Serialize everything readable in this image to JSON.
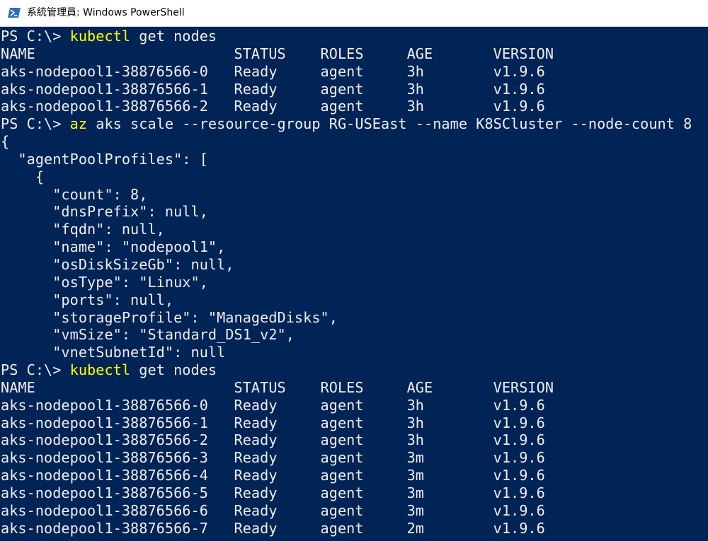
{
  "window": {
    "title": "系統管理員: Windows PowerShell",
    "icon": "powershell-icon"
  },
  "colors": {
    "console_background": "#012456",
    "console_text": "#eeedf0",
    "command_highlight": "#ffff00",
    "titlebar_background": "#ffffff"
  },
  "console": {
    "lines": [
      {
        "prompt": "PS C:\\> ",
        "cmd": "kubectl",
        "args": " get nodes"
      },
      {
        "text": "NAME                       STATUS    ROLES     AGE       VERSION"
      },
      {
        "text": "aks-nodepool1-38876566-0   Ready     agent     3h        v1.9.6"
      },
      {
        "text": "aks-nodepool1-38876566-1   Ready     agent     3h        v1.9.6"
      },
      {
        "text": "aks-nodepool1-38876566-2   Ready     agent     3h        v1.9.6"
      },
      {
        "prompt": "PS C:\\> ",
        "cmd": "az",
        "args": " aks scale --resource-group RG-USEast --name K8SCluster --node-count 8"
      },
      {
        "text": "{"
      },
      {
        "text": "  \"agentPoolProfiles\": ["
      },
      {
        "text": "    {"
      },
      {
        "text": "      \"count\": 8,"
      },
      {
        "text": "      \"dnsPrefix\": null,"
      },
      {
        "text": "      \"fqdn\": null,"
      },
      {
        "text": "      \"name\": \"nodepool1\","
      },
      {
        "text": "      \"osDiskSizeGb\": null,"
      },
      {
        "text": "      \"osType\": \"Linux\","
      },
      {
        "text": "      \"ports\": null,"
      },
      {
        "text": "      \"storageProfile\": \"ManagedDisks\","
      },
      {
        "text": "      \"vmSize\": \"Standard_DS1_v2\","
      },
      {
        "text": "      \"vnetSubnetId\": null"
      },
      {
        "prompt": "PS C:\\> ",
        "cmd": "kubectl",
        "args": " get nodes"
      },
      {
        "text": "NAME                       STATUS    ROLES     AGE       VERSION"
      },
      {
        "text": "aks-nodepool1-38876566-0   Ready     agent     3h        v1.9.6"
      },
      {
        "text": "aks-nodepool1-38876566-1   Ready     agent     3h        v1.9.6"
      },
      {
        "text": "aks-nodepool1-38876566-2   Ready     agent     3h        v1.9.6"
      },
      {
        "text": "aks-nodepool1-38876566-3   Ready     agent     3m        v1.9.6"
      },
      {
        "text": "aks-nodepool1-38876566-4   Ready     agent     3m        v1.9.6"
      },
      {
        "text": "aks-nodepool1-38876566-5   Ready     agent     3m        v1.9.6"
      },
      {
        "text": "aks-nodepool1-38876566-6   Ready     agent     3m        v1.9.6"
      },
      {
        "text": "aks-nodepool1-38876566-7   Ready     agent     2m        v1.9.6"
      }
    ]
  }
}
